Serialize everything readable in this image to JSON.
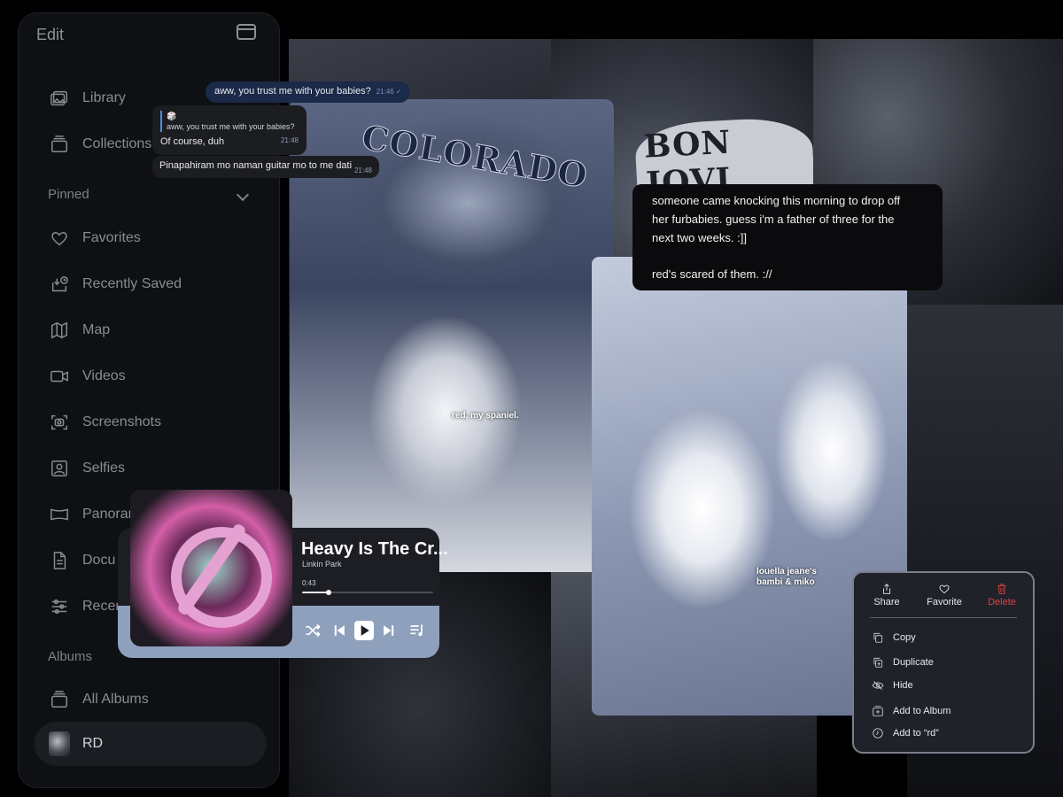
{
  "sidebar": {
    "edit_label": "Edit",
    "items": [
      {
        "label": "Library",
        "icon": "photo-library-icon"
      },
      {
        "label": "Collections",
        "icon": "collections-icon"
      },
      {
        "label": "Favorites",
        "icon": "heart-icon"
      },
      {
        "label": "Recently Saved",
        "icon": "download-clock-icon"
      },
      {
        "label": "Map",
        "icon": "map-icon"
      },
      {
        "label": "Videos",
        "icon": "video-camera-icon"
      },
      {
        "label": "Screenshots",
        "icon": "screenshot-icon"
      },
      {
        "label": "Selfies",
        "icon": "selfie-icon"
      },
      {
        "label": "Panorar",
        "icon": "panorama-icon"
      },
      {
        "label": "Docu",
        "icon": "document-icon"
      },
      {
        "label": "Recen",
        "icon": "sliders-icon"
      },
      {
        "label": "All Albums",
        "icon": "albums-stack-icon"
      },
      {
        "label": "RD",
        "icon": "album-thumbnail"
      }
    ],
    "pinned_label": "Pinned",
    "albums_label": "Albums",
    "selected_item": "RD"
  },
  "chat": {
    "sent": {
      "text": "aww, you trust me with your babies?",
      "time": "21:46"
    },
    "reply": {
      "quote_icon": "🎲",
      "quote": "aww, you trust me with your babies?",
      "text": "Of course, duh",
      "time": "21:48"
    },
    "second": {
      "text": "Pinapahiram mo naman guitar mo to me dati",
      "time": "21:48"
    }
  },
  "photos": {
    "spaniel_caption": "red, my spaniel.",
    "corgi_caption_line1": "louella jeane's",
    "corgi_caption_line2": "bambi & miko",
    "sweatshirt_text": "COLORADO",
    "jacket_text": "BON JOVI"
  },
  "note": {
    "paragraph1": "someone came knocking this morning to drop off\nher furbabies. guess i'm a father of three for the\nnext two weeks. :]]",
    "paragraph2": "red's scared of them. ://"
  },
  "player": {
    "title": "Heavy Is The Cr...",
    "artist": "Linkin Park",
    "elapsed": "0:43",
    "progress_fraction": 0.2,
    "controls_color": "#8fa0bd"
  },
  "context_menu": {
    "top_actions": [
      {
        "label": "Share",
        "icon": "share-icon"
      },
      {
        "label": "Favorite",
        "icon": "heart-icon"
      },
      {
        "label": "Delete",
        "icon": "trash-icon",
        "color": "#e0423f"
      }
    ],
    "items": [
      {
        "label": "Copy",
        "icon": "copy-icon"
      },
      {
        "label": "Duplicate",
        "icon": "duplicate-icon"
      },
      {
        "label": "Hide",
        "icon": "eye-slash-icon"
      },
      {
        "label": "Add to Album",
        "icon": "add-album-icon"
      },
      {
        "label": "Add to “rd”",
        "icon": "clock-icon"
      }
    ]
  }
}
